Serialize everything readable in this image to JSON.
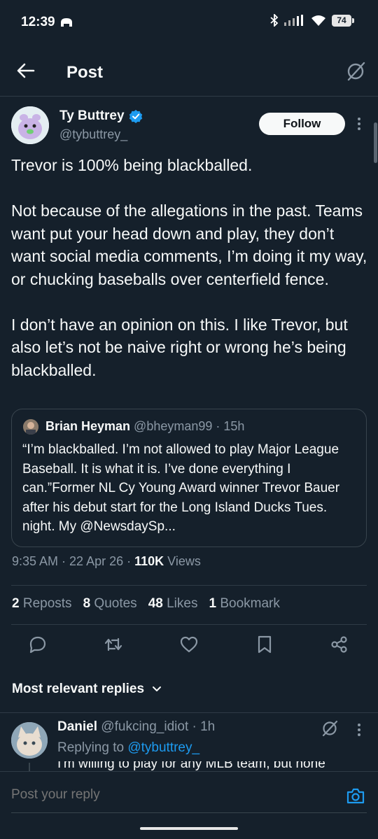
{
  "status_bar": {
    "time": "12:39",
    "battery": "74"
  },
  "header": {
    "title": "Post",
    "back_icon": "arrow-left-icon",
    "grok_icon": "grok-icon"
  },
  "post": {
    "author_name": "Ty Buttrey",
    "author_handle": "@tybuttrey_",
    "verified": true,
    "follow_label": "Follow",
    "text": "Trevor is 100% being blackballed.\n\nNot because of the allegations in the past. Teams want put your head down and play, they don’t want social media comments, I’m doing it my way, or chucking baseballs over centerfield fence.\n\nI don’t have an opinion on this. I like Trevor, but also let’s not be naive right or wrong he’s being blackballed.",
    "quote": {
      "name": "Brian Heyman",
      "handle_time": " @bheyman99 · 15h",
      "text": "“I’m blackballed. I’m not allowed to play Major League Baseball. It is what it is. I’ve done everything I can.”Former NL Cy Young Award winner Trevor Bauer after his debut start for the Long Island Ducks Tues. night. My @NewsdaySp..."
    },
    "timestamp": "9:35 AM · 22 Apr 26 · ",
    "views_count": "110K",
    "views_label": " Views",
    "stats": {
      "reposts_num": "2",
      "reposts_label": "Reposts",
      "quotes_num": "8",
      "quotes_label": "Quotes",
      "likes_num": "48",
      "likes_label": "Likes",
      "bookmarks_num": "1",
      "bookmarks_label": "Bookmark"
    },
    "actions": [
      "reply-icon",
      "repost-icon",
      "like-icon",
      "bookmark-icon",
      "share-icon"
    ]
  },
  "replies": {
    "sort_label": "Most relevant replies",
    "first": {
      "name": "Daniel",
      "meta": " @fukcing_idiot · 1h",
      "replying_prefix": "Replying to ",
      "replying_mention": "@tybuttrey_",
      "text": "I'm willing to play for any MLB team, but none"
    }
  },
  "composer": {
    "placeholder": "Post your reply"
  },
  "colors": {
    "background": "#15202b",
    "accent": "#1d9bf0",
    "muted": "#8b98a5",
    "text": "#f7f9f9"
  }
}
